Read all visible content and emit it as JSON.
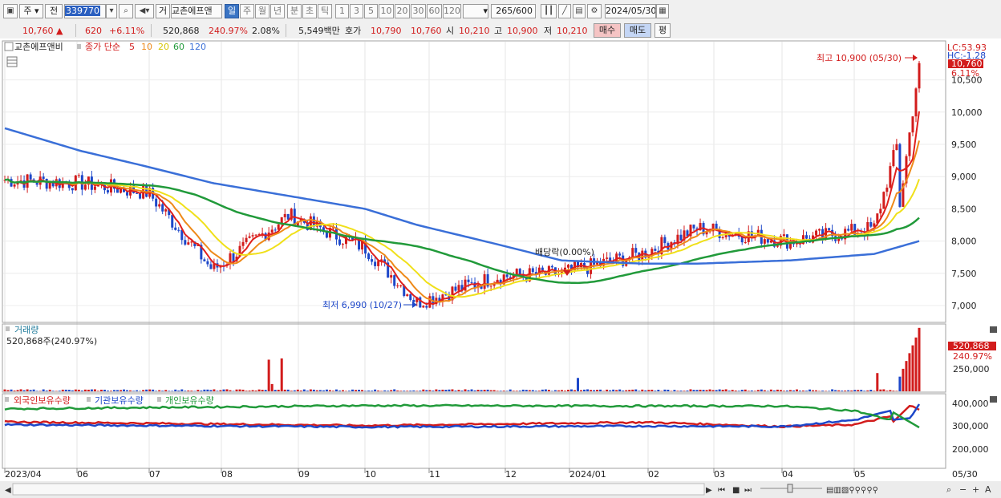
{
  "toolbar": {
    "market": "주",
    "prev": "전",
    "code": "339770",
    "period_tag": "거",
    "stock_name": "교촌에프앤",
    "periods": [
      "일",
      "주",
      "월",
      "년",
      "분",
      "초",
      "틱"
    ],
    "intervals": [
      "1",
      "3",
      "5",
      "10",
      "20",
      "30",
      "60",
      "120"
    ],
    "count": "265",
    "count_total": "/600",
    "date": "2024/05/30"
  },
  "info": {
    "price": "10,760",
    "arrow": "▲",
    "change": "620",
    "change_pct": "+6.11%",
    "volume": "520,868",
    "volume_ratio": "240.97%",
    "turnover_pct": "2.08%",
    "amount": "5,549백만",
    "ask_label": "호가",
    "ask": "10,790",
    "bid": "10,760",
    "open_label": "시",
    "open": "10,210",
    "high_label": "고",
    "high": "10,900",
    "low_label": "저",
    "low": "10,210",
    "buy": "매수",
    "sell": "매도",
    "avg": "평"
  },
  "price_panel": {
    "name": "교촌에프앤비",
    "ma_label": "종가 단순",
    "ma_periods": [
      "5",
      "10",
      "20",
      "60",
      "120"
    ],
    "lc_label": "LC:53.93",
    "hc_label": "HC:-1.28",
    "last_tag": "10,760",
    "pct_tag": "6.11%",
    "high_note": "최고 10,900 (05/30)",
    "low_note": "최저 6,990 (10/27)",
    "dividend_note": "배당락(0.00%)",
    "y_ticks": [
      "10,500",
      "10,000",
      "9,500",
      "9,000",
      "8,500",
      "8,000",
      "7,500",
      "7,000"
    ]
  },
  "volume_panel": {
    "title": "거래량",
    "value_label": "520,868주(240.97%)",
    "tag": "520,868",
    "pct_tag": "240.97%",
    "y_ticks": [
      "250,000"
    ]
  },
  "holdings_panel": {
    "labels": [
      "외국인보유수량",
      "기관보유수량",
      "개인보유수량"
    ],
    "y_ticks": [
      "400,000",
      "300,000",
      "200,000"
    ]
  },
  "x_axis": {
    "labels": [
      "2023/04",
      "06",
      "07",
      "08",
      "09",
      "10",
      "11",
      "12",
      "2024/01",
      "02",
      "03",
      "04",
      "05"
    ],
    "right_label": "05/30"
  },
  "colors": {
    "up": "#d21c1c",
    "down": "#1d47c9",
    "ma5": "#e0201c",
    "ma10": "#ee8a1a",
    "ma20": "#f0e01a",
    "ma60": "#219a3a",
    "ma120": "#3a6fd8"
  },
  "chart_data": [
    {
      "type": "line",
      "title": "교촌에프앤비 일봉",
      "x": [
        "2023/04",
        "2023/06",
        "2023/07",
        "2023/08",
        "2023/09",
        "2023/10",
        "2023/11",
        "2023/12",
        "2024/01",
        "2024/02",
        "2024/03",
        "2024/04",
        "2024/05",
        "2024/05/30"
      ],
      "series": [
        {
          "name": "5",
          "values": [
            8950,
            8900,
            8750,
            7550,
            8400,
            7900,
            7050,
            7450,
            7500,
            7800,
            8200,
            8000,
            8200,
            10760
          ]
        },
        {
          "name": "120",
          "values": [
            9750,
            9400,
            9150,
            8900,
            8700,
            8500,
            8250,
            7950,
            7700,
            7650,
            7650,
            7700,
            7800,
            8000
          ]
        }
      ],
      "ylim": [
        6800,
        11000
      ]
    },
    {
      "type": "bar",
      "title": "거래량",
      "categories": [
        "2023/08",
        "2023/09",
        "2024/01",
        "2024/05",
        "2024/05/30"
      ],
      "values": [
        80000,
        30000,
        20000,
        500000,
        520868
      ]
    },
    {
      "type": "line",
      "title": "보유수량",
      "x": [
        "2023/04",
        "2023/10",
        "2024/02",
        "2024/04",
        "2024/05",
        "2024/05/30"
      ],
      "series": [
        {
          "name": "외국인보유수량",
          "values": [
            210000,
            170000,
            205000,
            160000,
            180000,
            340000
          ]
        },
        {
          "name": "기관보유수량",
          "values": [
            180000,
            155000,
            165000,
            160000,
            230000,
            400000
          ]
        },
        {
          "name": "개인보유수량",
          "values": [
            350000,
            385000,
            380000,
            380000,
            330000,
            150000
          ]
        }
      ]
    }
  ]
}
